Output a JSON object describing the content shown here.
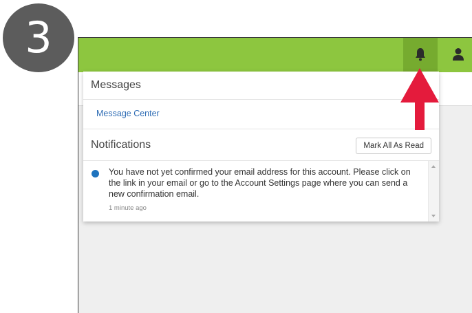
{
  "step": {
    "number": "3"
  },
  "header": {
    "bar_color": "#8dc63f",
    "active_button_color": "#76ab2f",
    "icons": [
      "bell-icon",
      "user-icon"
    ]
  },
  "dropdown": {
    "messages": {
      "title": "Messages",
      "link": "Message Center"
    },
    "notifications": {
      "title": "Notifications",
      "mark_all_label": "Mark All As Read",
      "items": [
        {
          "text": "You have not yet confirmed your email address for this account. Please click on the link in your email or go to the Account Settings page where you can send a new confirmation email.",
          "time": "1 minute ago",
          "unread": true
        }
      ]
    }
  },
  "annotation": {
    "arrow_color": "#e41b3c",
    "points_to": "bell-icon"
  }
}
